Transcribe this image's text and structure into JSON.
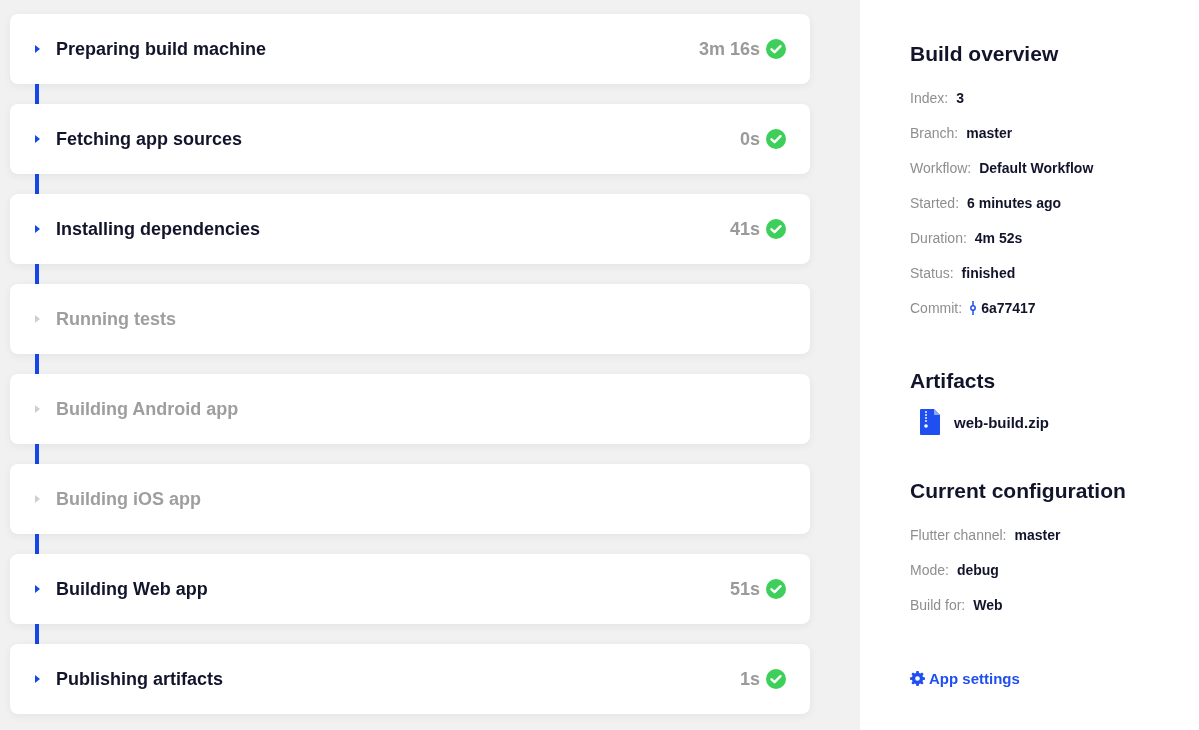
{
  "steps": [
    {
      "title": "Preparing build machine",
      "disabled": false,
      "duration": "3m 16s",
      "done": true
    },
    {
      "title": "Fetching app sources",
      "disabled": false,
      "duration": "0s",
      "done": true
    },
    {
      "title": "Installing dependencies",
      "disabled": false,
      "duration": "41s",
      "done": true
    },
    {
      "title": "Running tests",
      "disabled": true,
      "done": false
    },
    {
      "title": "Building Android app",
      "disabled": true,
      "done": false
    },
    {
      "title": "Building iOS app",
      "disabled": true,
      "done": false
    },
    {
      "title": "Building Web app",
      "disabled": false,
      "duration": "51s",
      "done": true
    },
    {
      "title": "Publishing artifacts",
      "disabled": false,
      "duration": "1s",
      "done": true
    }
  ],
  "overview": {
    "title": "Build overview",
    "fields": [
      {
        "label": "Index:",
        "value": "3"
      },
      {
        "label": "Branch:",
        "value": "master"
      },
      {
        "label": "Workflow:",
        "value": "Default Workflow"
      },
      {
        "label": "Started:",
        "value": "6 minutes ago"
      },
      {
        "label": "Duration:",
        "value": "4m 52s"
      },
      {
        "label": "Status:",
        "value": "finished"
      },
      {
        "label": "Commit:",
        "value": "6a77417",
        "kind": "commit"
      }
    ]
  },
  "artifacts": {
    "title": "Artifacts",
    "files": [
      "web-build.zip"
    ]
  },
  "configuration": {
    "title": "Current configuration",
    "fields": [
      {
        "label": "Flutter channel:",
        "value": "master"
      },
      {
        "label": "Mode:",
        "value": "debug"
      },
      {
        "label": "Build for:",
        "value": "Web"
      }
    ]
  },
  "settings_link": "App settings"
}
